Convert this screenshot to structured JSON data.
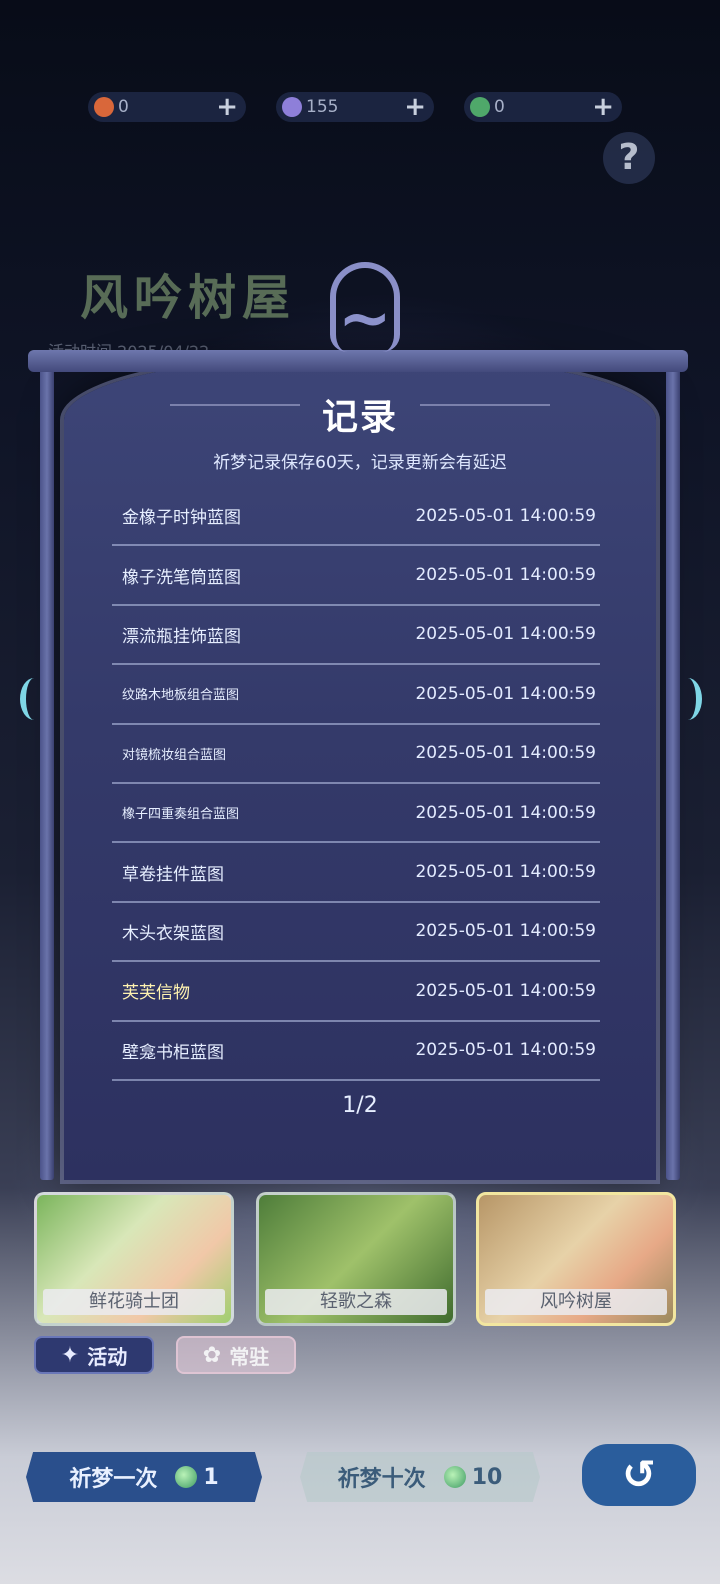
{
  "currencies": [
    {
      "icon": "flower-coin-icon",
      "value": "0",
      "plus": "+",
      "color": "#d9673a"
    },
    {
      "icon": "moon-coin-icon",
      "value": "155",
      "plus": "+",
      "color": "#8e7fd9"
    },
    {
      "icon": "leaf-gem-icon",
      "value": "0",
      "plus": "+",
      "color": "#4fa86a"
    }
  ],
  "help_label": "?",
  "background": {
    "title": "风吟树屋",
    "time_text": "活动时间 2025/04/22"
  },
  "modal": {
    "title": "记录",
    "subtitle": "祈梦记录保存60天，记录更新会有延迟",
    "records": [
      {
        "name": "金橡子时钟蓝图",
        "time": "2025-05-01 14:00:59"
      },
      {
        "name": "橡子洗笔筒蓝图",
        "time": "2025-05-01 14:00:59"
      },
      {
        "name": "漂流瓶挂饰蓝图",
        "time": "2025-05-01 14:00:59"
      },
      {
        "name": "纹路木地板组合蓝图",
        "time": "2025-05-01 14:00:59"
      },
      {
        "name": "对镜梳妆组合蓝图",
        "time": "2025-05-01 14:00:59"
      },
      {
        "name": "橡子四重奏组合蓝图",
        "time": "2025-05-01 14:00:59"
      },
      {
        "name": "草卷挂件蓝图",
        "time": "2025-05-01 14:00:59"
      },
      {
        "name": "木头衣架蓝图",
        "time": "2025-05-01 14:00:59"
      },
      {
        "name": "芙芙信物",
        "time": "2025-05-01 14:00:59"
      },
      {
        "name": "壁龛书柜蓝图",
        "time": "2025-05-01 14:00:59"
      }
    ],
    "page_indicator": "1/2"
  },
  "cards": [
    {
      "label": "鲜花骑士团"
    },
    {
      "label": "轻歌之森"
    },
    {
      "label": "风吟树屋"
    }
  ],
  "tabs": [
    {
      "label": "活动",
      "icon": "activity-icon"
    },
    {
      "label": "常驻",
      "icon": "permanent-icon"
    }
  ],
  "actions": {
    "pull_once": {
      "label": "祈梦一次",
      "cost": "1"
    },
    "pull_ten": {
      "label": "祈梦十次",
      "cost": "10"
    },
    "back_icon": "back-arrow-icon"
  }
}
